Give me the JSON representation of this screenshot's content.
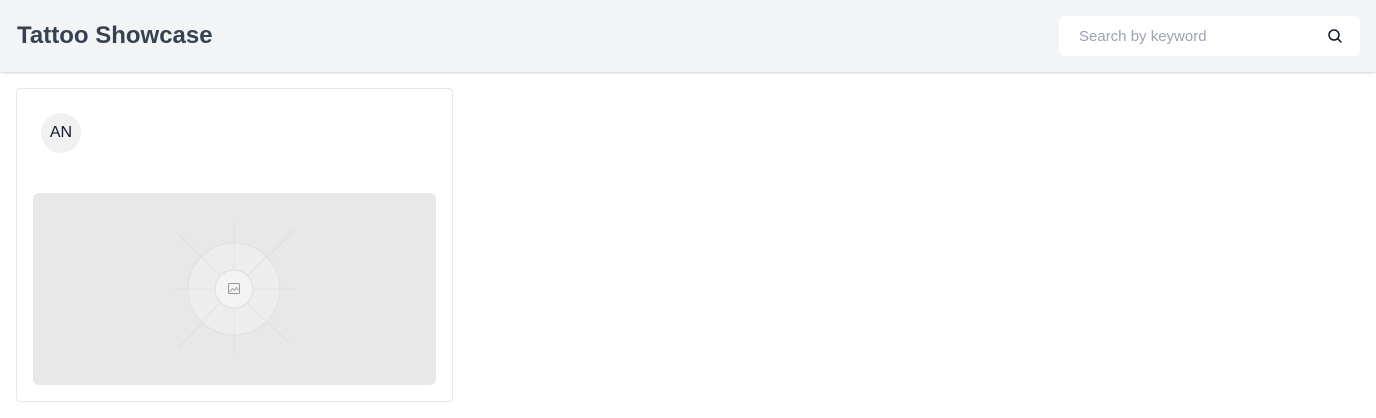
{
  "header": {
    "title": "Tattoo Showcase",
    "search": {
      "placeholder": "Search by keyword",
      "value": "",
      "button_icon": "search-icon"
    }
  },
  "cards": [
    {
      "avatar_initials": "AN",
      "image_icon": "image-placeholder-icon"
    }
  ],
  "colors": {
    "header_bg": "#f3f4f6",
    "title": "#374151",
    "placeholder": "#9ca3af",
    "image_bg": "#e8e8e8"
  }
}
